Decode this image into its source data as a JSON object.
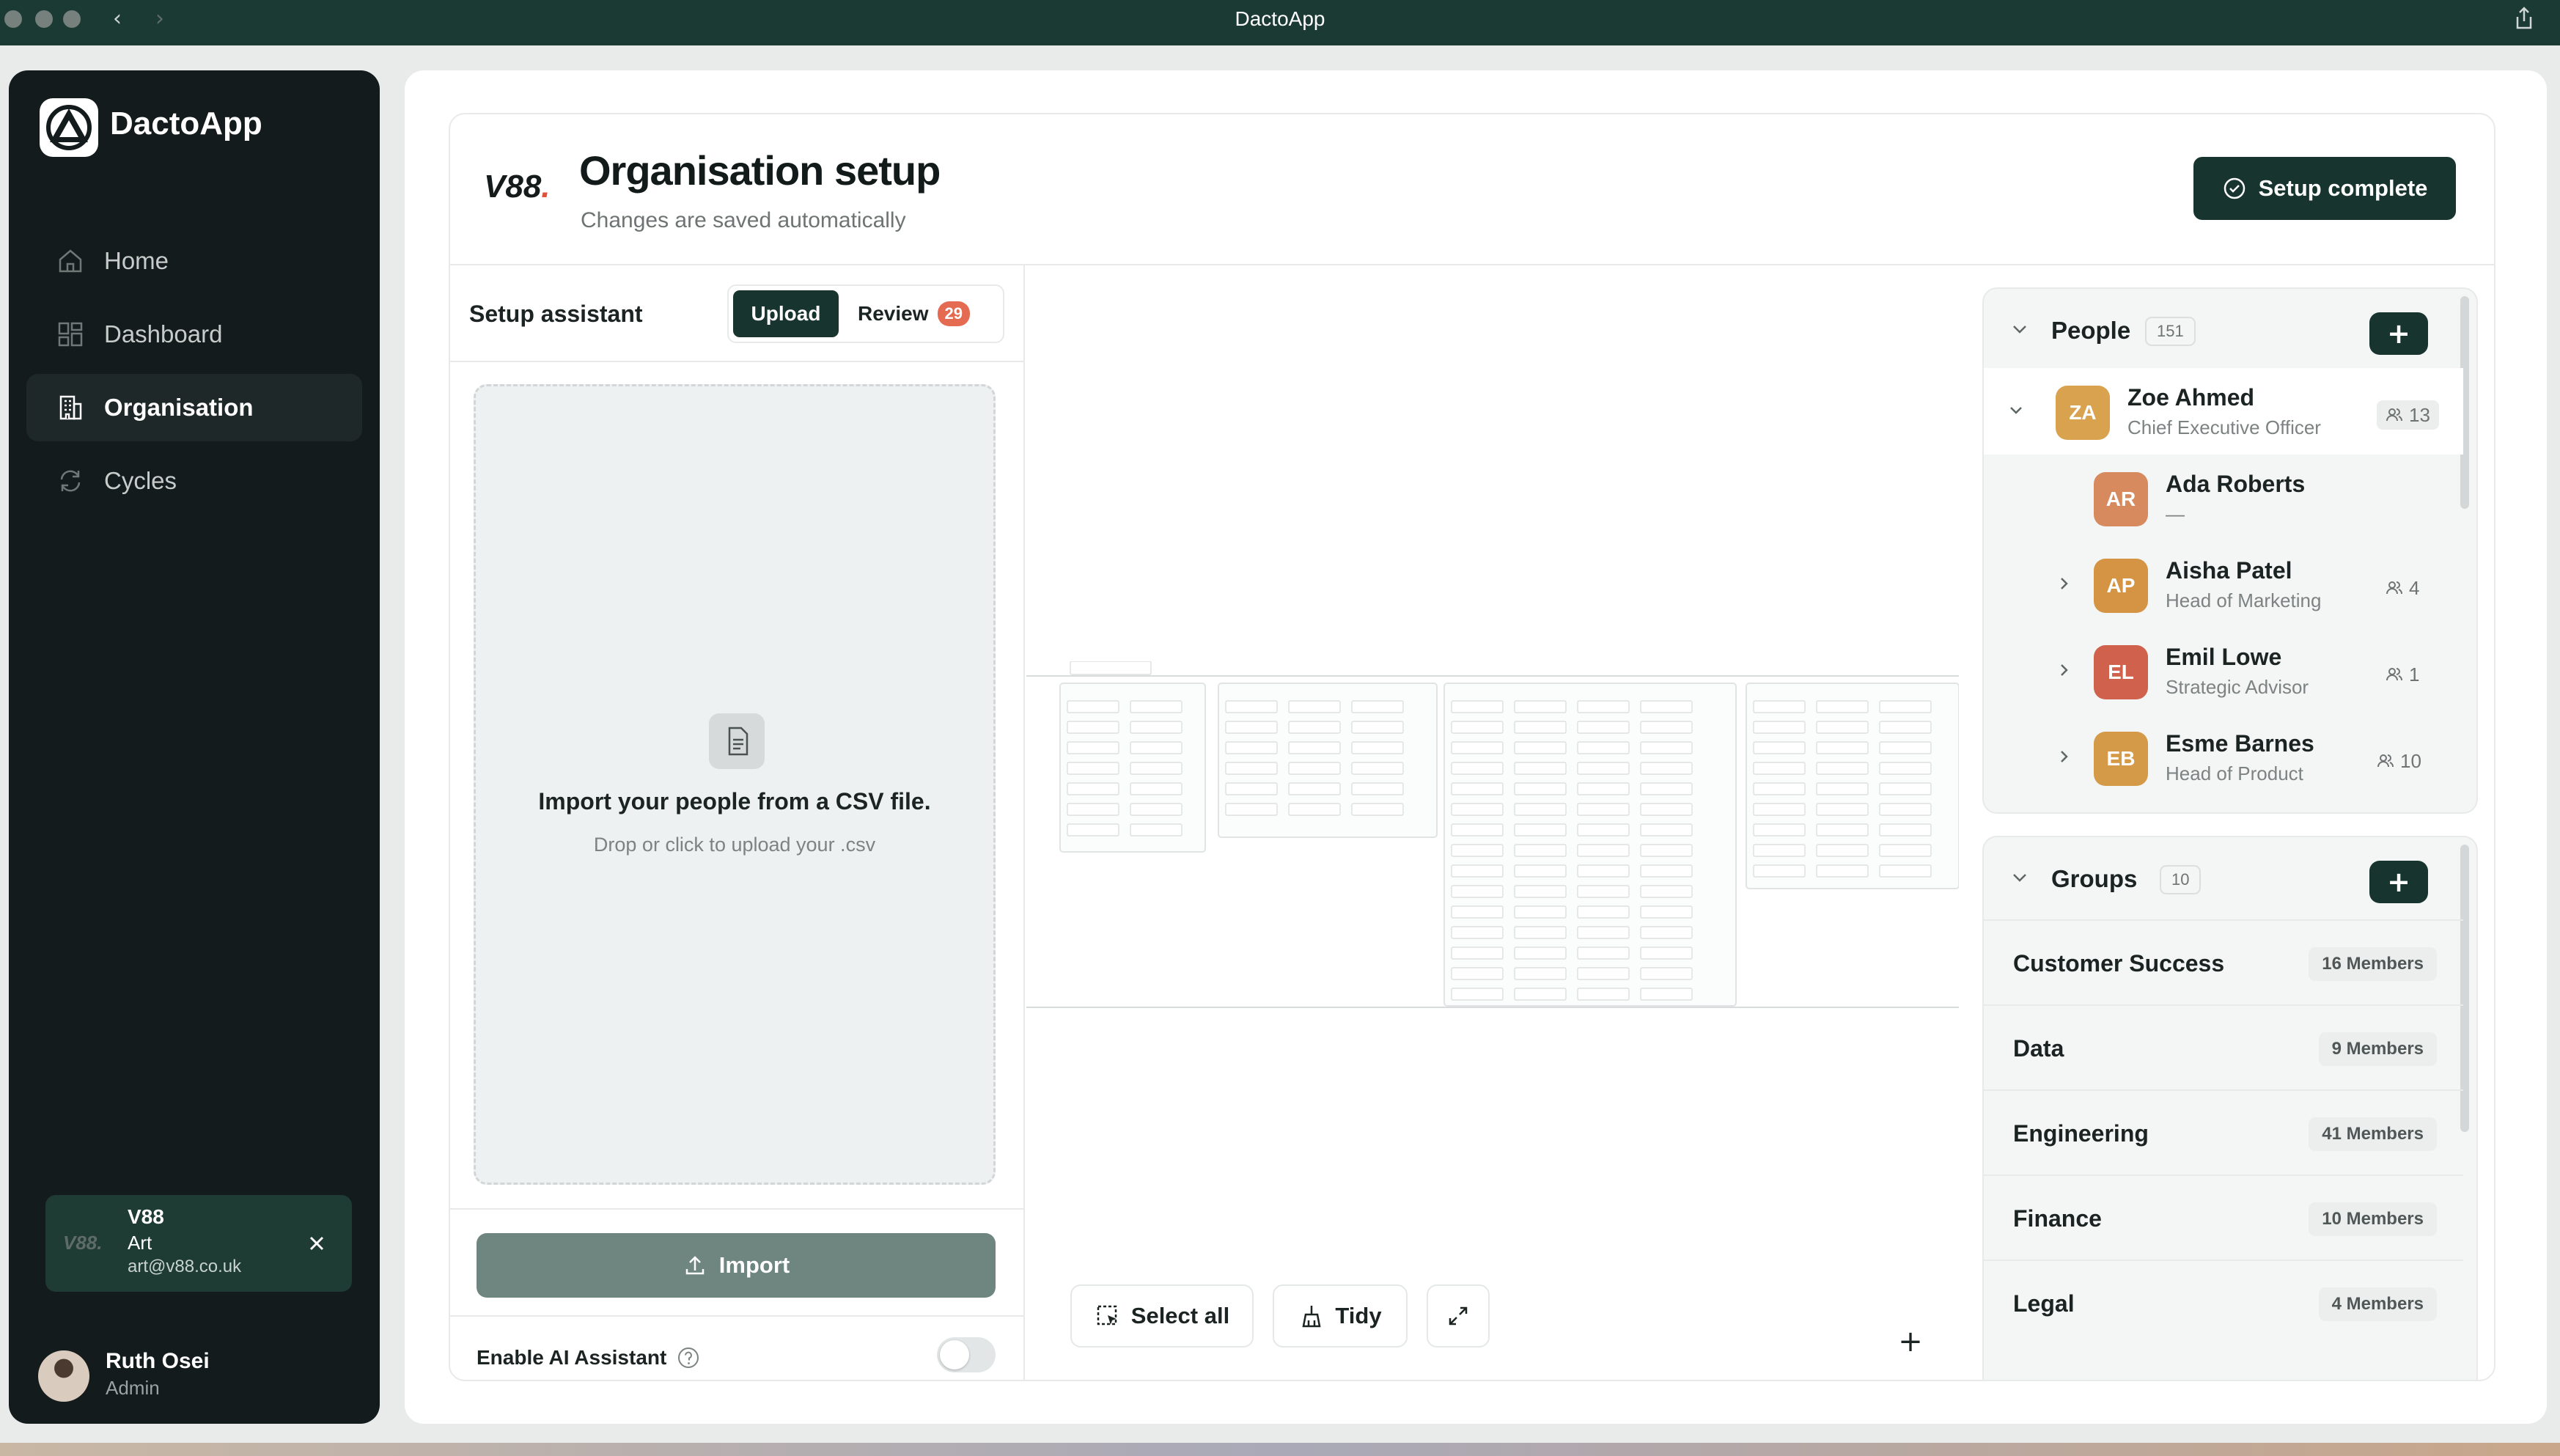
{
  "window": {
    "title": "DactoApp"
  },
  "sidebar": {
    "brand": "DactoApp",
    "items": [
      {
        "label": "Home",
        "icon": "home-icon"
      },
      {
        "label": "Dashboard",
        "icon": "dashboard-icon"
      },
      {
        "label": "Organisation",
        "icon": "building-icon",
        "active": true
      },
      {
        "label": "Cycles",
        "icon": "refresh-icon"
      }
    ],
    "org_card": {
      "logo": "V88.",
      "name": "V88",
      "subtitle": "Art",
      "email": "art@v88.co.uk"
    },
    "user": {
      "name": "Ruth Osei",
      "role": "Admin"
    }
  },
  "header": {
    "logo": "V88",
    "logo_dot": ".",
    "title": "Organisation setup",
    "subtitle": "Changes are saved automatically",
    "complete_button": "Setup complete"
  },
  "assistant": {
    "title": "Setup assistant",
    "tab_upload": "Upload",
    "tab_review": "Review",
    "review_count": "29",
    "drop_title": "Import your people from a CSV file.",
    "drop_sub": "Drop or click to upload your .csv",
    "import_button": "Import",
    "ai_label": "Enable AI Assistant",
    "ai_enabled": false
  },
  "canvas": {
    "select_all": "Select all",
    "tidy": "Tidy"
  },
  "people": {
    "title": "People",
    "count": "151",
    "items": [
      {
        "initials": "ZA",
        "name": "Zoe Ahmed",
        "role": "Chief Executive Officer",
        "reports": "13",
        "color": "#d9a24e"
      },
      {
        "initials": "AR",
        "name": "Ada Roberts",
        "role": "—",
        "reports": "",
        "color": "#d78a5e"
      },
      {
        "initials": "AP",
        "name": "Aisha Patel",
        "role": "Head of Marketing",
        "reports": "4",
        "color": "#d49443"
      },
      {
        "initials": "EL",
        "name": "Emil Lowe",
        "role": "Strategic Advisor",
        "reports": "1",
        "color": "#d0614c"
      },
      {
        "initials": "EB",
        "name": "Esme Barnes",
        "role": "Head of Product",
        "reports": "10",
        "color": "#d59a47"
      }
    ]
  },
  "groups": {
    "title": "Groups",
    "count": "10",
    "items": [
      {
        "name": "Customer Success",
        "members": "16 Members"
      },
      {
        "name": "Data",
        "members": "9 Members"
      },
      {
        "name": "Engineering",
        "members": "41 Members"
      },
      {
        "name": "Finance",
        "members": "10 Members"
      },
      {
        "name": "Legal",
        "members": "4 Members"
      }
    ]
  },
  "colors": {
    "accent": "#17352e",
    "badge": "#e46a52",
    "sidebar": "#141b1c"
  }
}
